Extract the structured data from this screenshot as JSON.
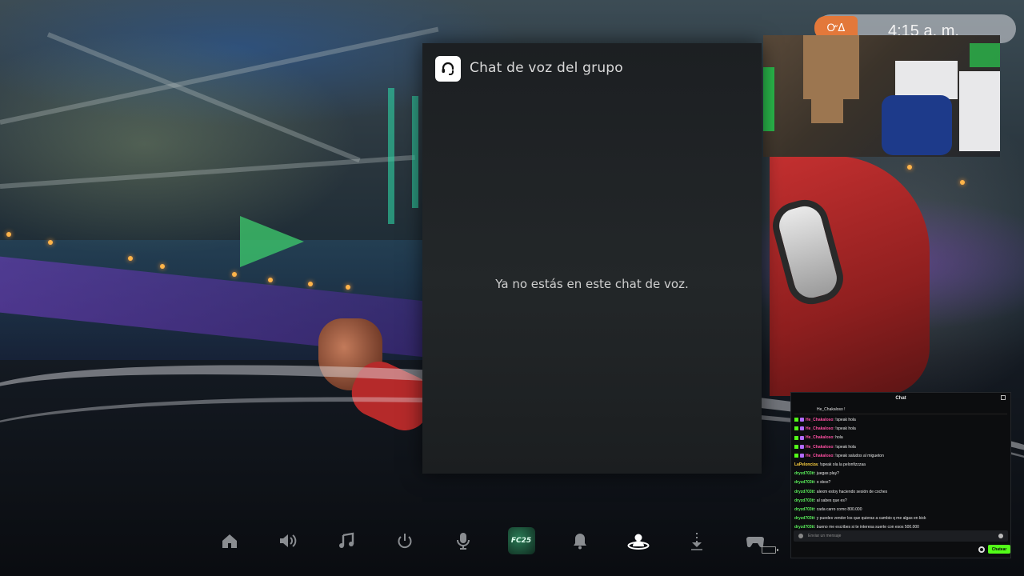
{
  "voice_panel": {
    "title": "Chat de voz del grupo",
    "message": "Ya no estás en este chat de voz.",
    "icon": "headset-icon"
  },
  "status": {
    "time": "4:15 a. m.",
    "badge_icons": "ᏅΔ"
  },
  "text_chat": {
    "title": "Chat",
    "pinned": "He_Chakaloso !",
    "input_placeholder": "Enviar un mensaje",
    "send_label": "Chatear",
    "messages": [
      {
        "user": "He_Chakaloso",
        "text": "!speak hola",
        "user_color": "#ff4fa3",
        "badges": 2
      },
      {
        "user": "He_Chakaloso",
        "text": "!speak hola",
        "user_color": "#ff4fa3",
        "badges": 2
      },
      {
        "user": "He_Chakaloso",
        "text": "hola",
        "user_color": "#ff4fa3",
        "badges": 2
      },
      {
        "user": "He_Chakaloso",
        "text": "!speak hola",
        "user_color": "#ff4fa3",
        "badges": 2
      },
      {
        "user": "He_Chakaloso",
        "text": "!speak saludos al migueton",
        "user_color": "#ff4fa3",
        "badges": 2
      },
      {
        "user": "LaPelonciza",
        "text": "!speak ola la pelonfizzzaa",
        "user_color": "#ffd23f",
        "badges": 0
      },
      {
        "user": "dryzd703tt",
        "text": "juegas play?",
        "user_color": "#5cf25c",
        "badges": 0
      },
      {
        "user": "dryzd703tt",
        "text": "o xbox?",
        "user_color": "#5cf25c",
        "badges": 0
      },
      {
        "user": "dryzd703tt",
        "text": "alexm estoy haciendo sesión de coches",
        "user_color": "#5cf25c",
        "badges": 0
      },
      {
        "user": "dryzd703tt",
        "text": "al sabes que es?",
        "user_color": "#5cf25c",
        "badges": 0
      },
      {
        "user": "dryzd703tt",
        "text": "cada carro como 800.000",
        "user_color": "#5cf25c",
        "badges": 0
      },
      {
        "user": "dryzd703tt",
        "text": "y puedes vender los que quieras a cambio q me algas en kick",
        "user_color": "#5cf25c",
        "badges": 0
      },
      {
        "user": "dryzd703tt",
        "text": "bueno me escribes si te interesa suerte con esos 500.000",
        "user_color": "#5cf25c",
        "badges": 0
      }
    ]
  },
  "control_bar": {
    "items": [
      {
        "name": "home-icon",
        "active": false
      },
      {
        "name": "sound-icon",
        "active": false
      },
      {
        "name": "music-icon",
        "active": false
      },
      {
        "name": "power-icon",
        "active": false
      },
      {
        "name": "mic-icon",
        "active": false
      },
      {
        "name": "game-fc25-icon",
        "label": "FC25",
        "active": false
      },
      {
        "name": "notifications-icon",
        "active": false
      },
      {
        "name": "game-base-icon",
        "active": true
      },
      {
        "name": "downloads-icon",
        "active": false
      },
      {
        "name": "accessories-icon",
        "active": false
      }
    ]
  },
  "colors": {
    "accent_send": "#53fc18",
    "badge_orange": "#e3783a",
    "panel_bg": "#202426"
  }
}
